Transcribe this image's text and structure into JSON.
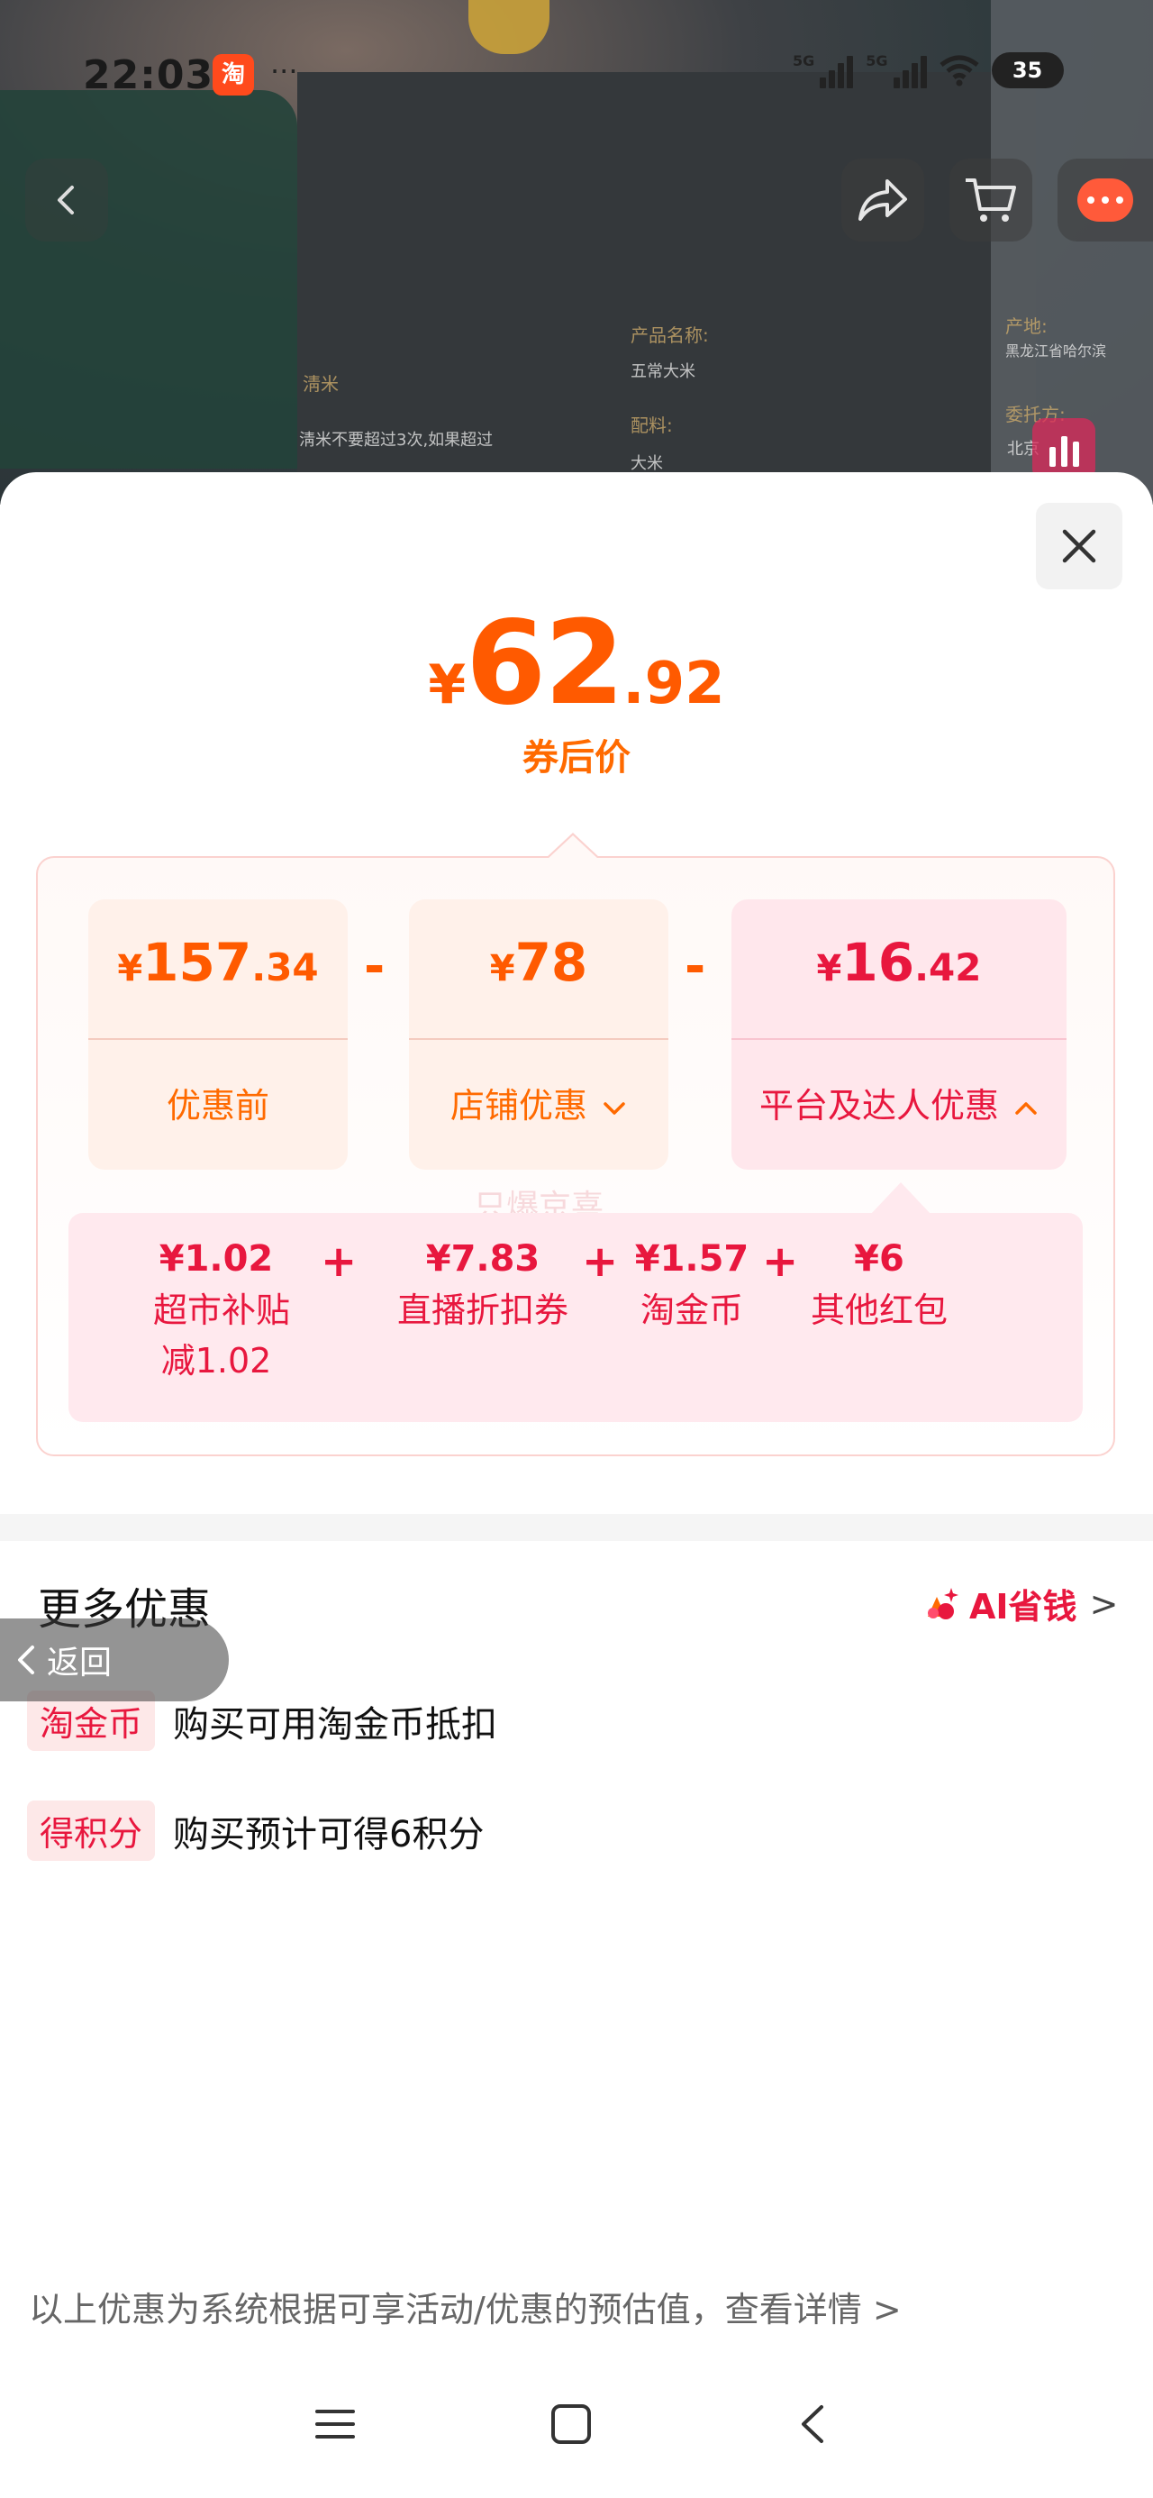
{
  "status_bar": {
    "time": "22:03",
    "app_icon_text": "淘",
    "more_dots": "···",
    "network_1": "5G",
    "network_2": "5G",
    "battery": "35"
  },
  "top_nav": {
    "back_icon": "chevron-left-icon",
    "share_icon": "share-icon",
    "cart_icon": "cart-icon",
    "message_icon": "message-icon"
  },
  "background_text": {
    "product_name_label": "产品名称:",
    "product_name": "五常大米",
    "ingredients_label": "配料:",
    "ingredients": "大米",
    "wash_title": "淸米",
    "wash_note": "淸米不要超过3次,如果超过",
    "origin_label": "产地:",
    "origin": "黑龙江省哈尔滨",
    "client_label": "委托方:",
    "client": "北京"
  },
  "price": {
    "currency": "¥",
    "integer": "62",
    "decimal": ".92",
    "label": "券后价"
  },
  "breakdown": {
    "minus_symbol": "-",
    "cards": [
      {
        "currency": "¥",
        "integer": "157",
        "decimal": ".34",
        "label": "优惠前"
      },
      {
        "currency": "¥",
        "integer": "78",
        "decimal": "",
        "label": "店铺优惠"
      },
      {
        "currency": "¥",
        "integer": "16",
        "decimal": ".42",
        "label": "平台及达人优惠"
      }
    ],
    "sub_items": [
      {
        "value": "¥1.02",
        "label": "超市补贴",
        "note": "减1.02"
      },
      {
        "value": "¥7.83",
        "label": "直播折扣券",
        "note": ""
      },
      {
        "value": "¥1.57",
        "label": "淘金币",
        "note": ""
      },
      {
        "value": "¥6",
        "label": "其他红包",
        "note": ""
      }
    ],
    "plus_symbol": "+",
    "watermark": "只爆京喜"
  },
  "more": {
    "title": "更多优惠",
    "ai_save": "AI省钱",
    "ai_chevron": ">",
    "back_label": "返回",
    "rows": [
      {
        "tag": "淘金币",
        "text": "购买可用淘金币抵扣"
      },
      {
        "tag": "得积分",
        "text": "购买预计可得6积分"
      }
    ]
  },
  "footer": {
    "note": "以上优惠为系统根据可享活动/优惠的预估值，查看详情 >"
  },
  "colors": {
    "orange": "#ff5a00",
    "red": "#e8173e",
    "card_orange_bg": "#fff1ea",
    "card_pink_bg": "#ffe7ec"
  }
}
